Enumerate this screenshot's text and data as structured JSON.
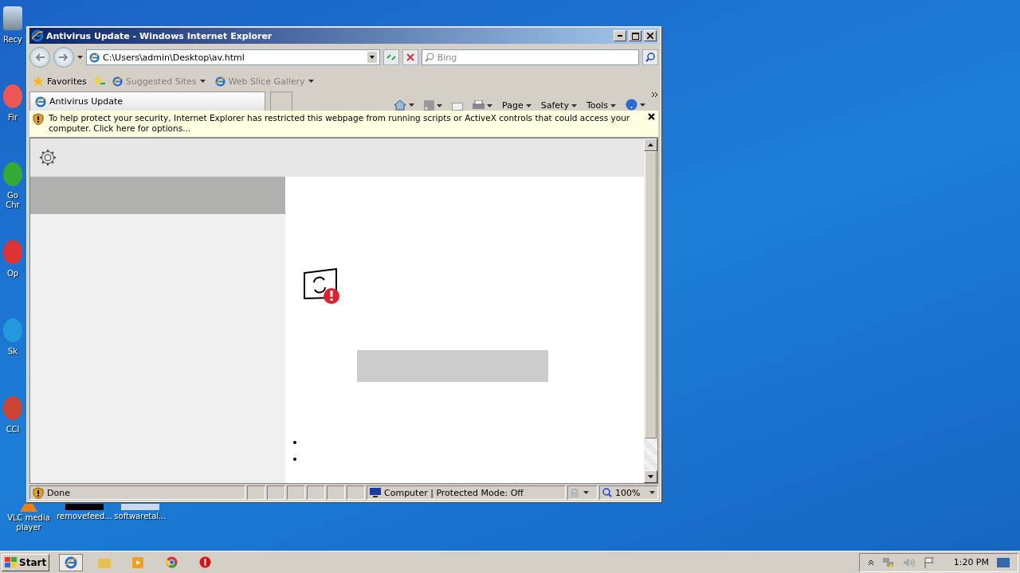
{
  "desktop_icons": [
    {
      "label": "Recy",
      "kind": "bin"
    },
    {
      "label": "Fir",
      "kind": "app"
    },
    {
      "label": "Go\nChr",
      "kind": "app"
    },
    {
      "label": "Op",
      "kind": "app"
    },
    {
      "label": "Sk",
      "kind": "app"
    },
    {
      "label": "CCl",
      "kind": "app"
    }
  ],
  "desktop_bottom_icons": [
    {
      "label": "VLC media player"
    },
    {
      "label": "removefeed..."
    },
    {
      "label": "softwaretal..."
    }
  ],
  "window": {
    "title": "Antivirus Update - Windows Internet Explorer"
  },
  "address": {
    "value": "C:\\Users\\admin\\Desktop\\av.html"
  },
  "search": {
    "placeholder": "Bing"
  },
  "favorites_bar": {
    "favorites": "Favorites",
    "links": [
      "Suggested Sites",
      "Web Slice Gallery"
    ]
  },
  "tab": {
    "label": "Antivirus Update"
  },
  "command_bar": [
    "Page",
    "Safety",
    "Tools"
  ],
  "info_bar": {
    "message": "To help protect your security, Internet Explorer has restricted this webpage from running scripts or ActiveX controls that could access your computer. Click here for options..."
  },
  "status_bar": {
    "status": "Done",
    "zone": "Computer | Protected Mode: Off",
    "zoom": "100%"
  },
  "taskbar": {
    "start": "Start",
    "clock": "1:20 PM"
  }
}
